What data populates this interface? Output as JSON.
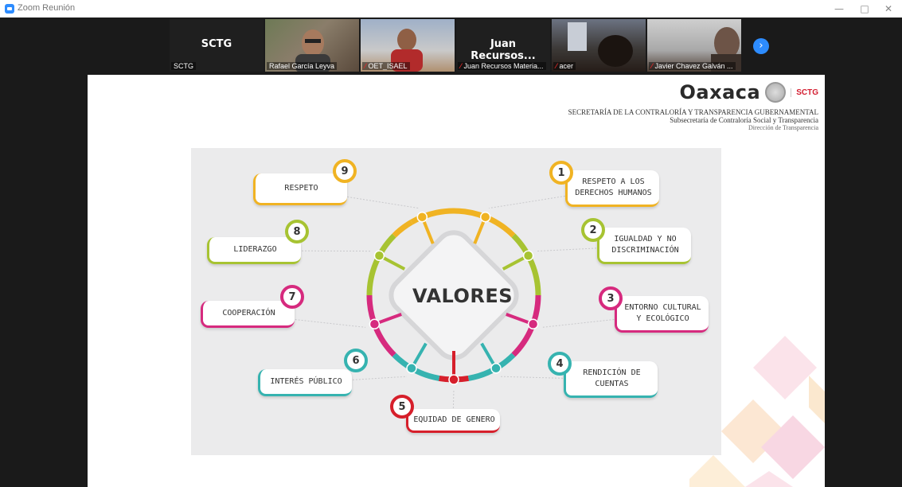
{
  "window": {
    "title": "Zoom Reunión",
    "controls": [
      "—",
      "□",
      "✕"
    ]
  },
  "participants": [
    {
      "big": "SCTG",
      "label": "SCTG",
      "muted": false,
      "video": false
    },
    {
      "big": "",
      "label": "Rafael García Leyva",
      "muted": false,
      "video": true
    },
    {
      "big": "",
      "label": "OET_ISAEL",
      "muted": true,
      "video": true
    },
    {
      "big": "Juan Recursos...",
      "label": "Juan Recursos Materia...",
      "muted": true,
      "video": false
    },
    {
      "big": "",
      "label": "acer",
      "muted": true,
      "video": true
    },
    {
      "big": "",
      "label": "Javier Chavez Galván ...",
      "muted": true,
      "video": true
    }
  ],
  "next_icon": "chevron-right-icon",
  "slide": {
    "brand": "Oaxaca",
    "sctg": "SCTG",
    "line1": "SECRETARÍA DE LA CONTRALORÍA Y TRANSPARENCIA GUBERNAMENTAL",
    "line2": "Subsecretaría de Contraloría Social y Transparencia",
    "line3": "Dirección de Transparencia",
    "center": "VALORES",
    "values": [
      {
        "num": "1",
        "text": "RESPETO A LOS\nDERECHOS HUMANOS",
        "color": "#f0b323"
      },
      {
        "num": "2",
        "text": "IGUALDAD Y NO\nDISCRIMINACIÓN",
        "color": "#a7c332"
      },
      {
        "num": "3",
        "text": "ENTORNO CULTURAL\nY ECOLÓGICO",
        "color": "#d62a7e"
      },
      {
        "num": "4",
        "text": "RENDICIÓN DE\nCUENTAS",
        "color": "#36b3b0"
      },
      {
        "num": "5",
        "text": "EQUIDAD DE GENERO",
        "color": "#d61f2b"
      },
      {
        "num": "6",
        "text": "INTERÉS PÚBLICO",
        "color": "#36b3b0"
      },
      {
        "num": "7",
        "text": "COOPERACIÓN",
        "color": "#d62a7e"
      },
      {
        "num": "8",
        "text": "LIDERAZGO",
        "color": "#a7c332"
      },
      {
        "num": "9",
        "text": "RESPETO",
        "color": "#f0b323"
      }
    ]
  }
}
